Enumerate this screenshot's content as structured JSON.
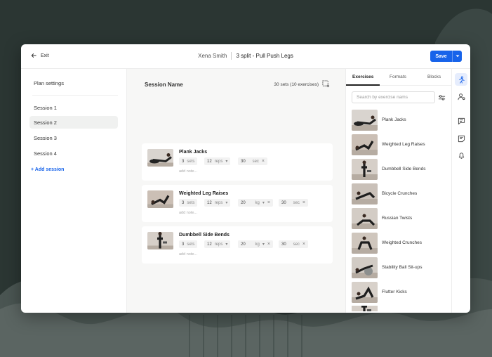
{
  "colors": {
    "accent": "#1763ea",
    "background": "#2b3633"
  },
  "header": {
    "exit_label": "Exit",
    "client_name": "Xena Smith",
    "plan_name": "3 split -  Pull Push Legs",
    "save_label": "Save"
  },
  "sidebar": {
    "plan_settings": "Plan settings",
    "sessions": [
      {
        "label": "Session 1",
        "active": false
      },
      {
        "label": "Session 2",
        "active": true
      },
      {
        "label": "Session 3",
        "active": false
      },
      {
        "label": "Session 4",
        "active": false
      }
    ],
    "add_session": "+ Add session"
  },
  "main": {
    "session_title": "Session Name",
    "summary": "30 sets (10 exercises)",
    "exercises": [
      {
        "name": "Plank Jacks",
        "sets": "3",
        "sets_unit": "sets",
        "reps": "12",
        "reps_unit": "reps",
        "time": "30",
        "time_unit": "sec",
        "note_placeholder": "add note..."
      },
      {
        "name": "Weighted Leg Raises",
        "sets": "3",
        "sets_unit": "sets",
        "reps": "12",
        "reps_unit": "reps",
        "weight": "20",
        "weight_unit": "kg",
        "time": "30",
        "time_unit": "sec",
        "note_placeholder": "add note..."
      },
      {
        "name": "Dumbbell Side Bends",
        "sets": "3",
        "sets_unit": "sets",
        "reps": "12",
        "reps_unit": "reps",
        "weight": "20",
        "weight_unit": "kg",
        "time": "30",
        "time_unit": "sec",
        "note_placeholder": "add note..."
      }
    ]
  },
  "library": {
    "tabs": [
      "Exercises",
      "Formats",
      "Blocks"
    ],
    "active_tab": "Exercises",
    "search_placeholder": "Search by exercise nams",
    "items": [
      "Plank Jacks",
      "Weighted Leg Raises",
      "Dumbbell Side Bends",
      "Bicycle Crunches",
      "Russian Twists",
      "Weighted Crunches",
      "Stability Ball Sit-ups",
      "Flutter Kicks"
    ]
  },
  "rail": [
    "exercise-library-icon",
    "client-profile-icon",
    "chat-icon",
    "notes-icon",
    "bell-icon"
  ]
}
